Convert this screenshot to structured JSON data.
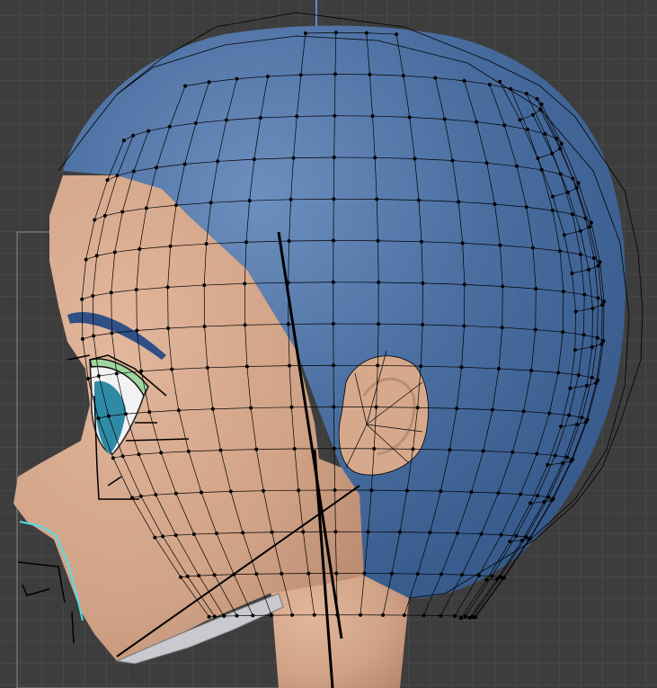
{
  "viewport": {
    "background_color": "#3d3d3d",
    "grid_color": "#474747"
  },
  "model": {
    "skin_color": "#d6a98d",
    "hair_color": "#4a6ea0",
    "eye_color": "#2f8aa6",
    "eye_outline_color": "#9fd6a0",
    "edge_color": "#000000",
    "selected_edge_color": "#4fe0e8",
    "axis_color": "#5b8ccf",
    "helmet_color": "#c9c9cf"
  },
  "icons": [
    "ear-icon",
    "eye-icon"
  ]
}
